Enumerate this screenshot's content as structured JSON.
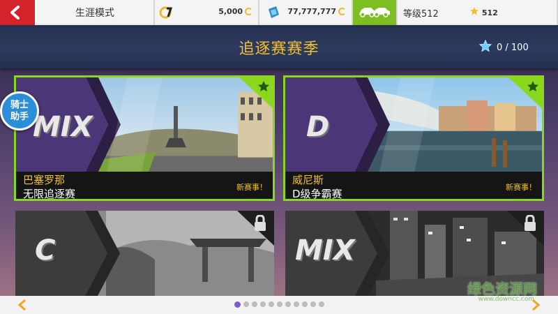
{
  "topbar": {
    "mode_label": "生涯模式",
    "credits": "5,000",
    "tokens": "77,777,777",
    "level_label": "等级512",
    "stars": "512"
  },
  "header": {
    "title": "追逐赛赛季",
    "star_progress": "0 / 100"
  },
  "cards": [
    {
      "class": "MIX",
      "city": "巴塞罗那",
      "event": "无限追逐赛",
      "status": "新赛事！",
      "state": "unlocked"
    },
    {
      "class": "D",
      "city": "威尼斯",
      "event": "D级争霸赛",
      "status": "新赛事！",
      "state": "unlocked"
    },
    {
      "class": "C",
      "state": "locked"
    },
    {
      "class": "MIX",
      "state": "locked"
    }
  ],
  "helper_badge": "骑士\n助手",
  "helper_line1": "骑士",
  "helper_line2": "助手",
  "pagination": {
    "pages": 11,
    "current": 1
  },
  "watermark": {
    "text": "绿色资源网",
    "url": "www.downcc.com"
  },
  "colors": {
    "accent_yellow": "#f3c12b",
    "accent_green": "#8ad71e",
    "back_red": "#d4232b",
    "helper_blue": "#2d8ed8"
  }
}
